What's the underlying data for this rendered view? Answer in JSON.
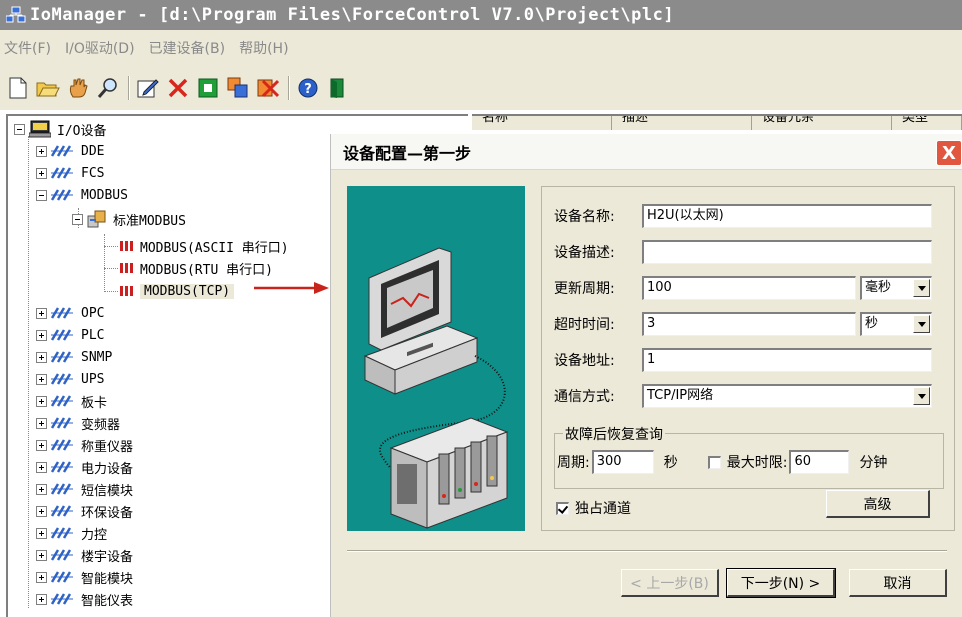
{
  "window": {
    "title": "IoManager - [d:\\Program Files\\ForceControl V7.0\\Project\\plc]"
  },
  "menu": [
    "文件(F)",
    "I/O驱动(D)",
    "已建设备(B)",
    "帮助(H)"
  ],
  "toolbar": [
    "new-file-icon",
    "open-folder-icon",
    "hand-icon",
    "search-icon",
    "edit-icon",
    "delete-icon",
    "run-icon",
    "copy-icon",
    "delete-all-icon",
    "help-icon",
    "exit-icon"
  ],
  "tree": {
    "root": "I/O设备",
    "nodes": [
      "DDE",
      "FCS",
      "MODBUS",
      "OPC",
      "PLC",
      "SNMP",
      "UPS",
      "板卡",
      "变频器",
      "称重仪器",
      "电力设备",
      "短信模块",
      "环保设备",
      "力控",
      "楼宇设备",
      "智能模块",
      "智能仪表"
    ],
    "modbus_child": "标准MODBUS",
    "modbus_devices": [
      "MODBUS(ASCII 串行口)",
      "MODBUS(RTU 串行口)",
      "MODBUS(TCP)"
    ]
  },
  "list": {
    "columns": [
      "名称",
      "描述",
      "设备冗余",
      "类型"
    ]
  },
  "dialog": {
    "title": "设备配置—第一步",
    "close": "X",
    "fields": {
      "name_label": "设备名称:",
      "name_value": "H2U(以太网)",
      "desc_label": "设备描述:",
      "desc_value": "",
      "period_label": "更新周期:",
      "period_value": "100",
      "period_unit": "毫秒",
      "timeout_label": "超时时间:",
      "timeout_value": "3",
      "timeout_unit": "秒",
      "addr_label": "设备地址:",
      "addr_value": "1",
      "comm_label": "通信方式:",
      "comm_value": "TCP/IP网络"
    },
    "recovery": {
      "title": "故障后恢复查询",
      "period_label": "周期:",
      "period_value": "300",
      "period_unit": "秒",
      "max_label": "最大时限:",
      "max_value": "60",
      "max_unit": "分钟"
    },
    "exclusive_label": "独占通道",
    "advanced_button": "高级",
    "prev_button": "< 上一步(B)",
    "next_button": "下一步(N) >",
    "cancel_button": "取消"
  }
}
